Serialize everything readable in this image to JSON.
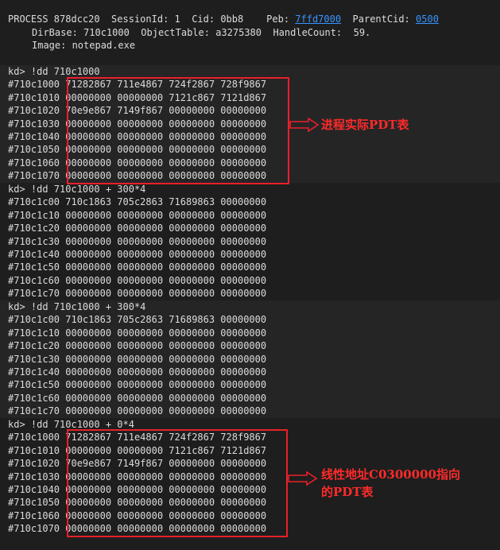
{
  "header": {
    "line1": {
      "process": "PROCESS 878dcc20",
      "session": "SessionId: 1",
      "cid": "Cid: 0bb8",
      "peb_label": "Peb:",
      "peb_value": "7ffd7000",
      "parent_label": "ParentCid:",
      "parent_value": "0500"
    },
    "line2": {
      "dirbase": "DirBase: 710c1000",
      "objtable": "ObjectTable: a3275380",
      "handlecount": "HandleCount:  59."
    },
    "line3": "Image: notepad.exe"
  },
  "blocks": [
    {
      "command": "kd> !dd 710c1000",
      "rows": [
        "#710c1000 71282867 711e4867 724f2867 728f9867",
        "#710c1010 00000000 00000000 7121c867 7121d867",
        "#710c1020 70e9e867 7149f867 00000000 00000000",
        "#710c1030 00000000 00000000 00000000 00000000",
        "#710c1040 00000000 00000000 00000000 00000000",
        "#710c1050 00000000 00000000 00000000 00000000",
        "#710c1060 00000000 00000000 00000000 00000000",
        "#710c1070 00000000 00000000 00000000 00000000"
      ]
    },
    {
      "command": "kd> !dd 710c1000 + 300*4",
      "rows": [
        "#710c1c00 710c1863 705c2863 71689863 00000000",
        "#710c1c10 00000000 00000000 00000000 00000000",
        "#710c1c20 00000000 00000000 00000000 00000000",
        "#710c1c30 00000000 00000000 00000000 00000000",
        "#710c1c40 00000000 00000000 00000000 00000000",
        "#710c1c50 00000000 00000000 00000000 00000000",
        "#710c1c60 00000000 00000000 00000000 00000000",
        "#710c1c70 00000000 00000000 00000000 00000000"
      ]
    },
    {
      "command": "kd> !dd 710c1000 + 300*4",
      "rows": [
        "#710c1c00 710c1863 705c2863 71689863 00000000",
        "#710c1c10 00000000 00000000 00000000 00000000",
        "#710c1c20 00000000 00000000 00000000 00000000",
        "#710c1c30 00000000 00000000 00000000 00000000",
        "#710c1c40 00000000 00000000 00000000 00000000",
        "#710c1c50 00000000 00000000 00000000 00000000",
        "#710c1c60 00000000 00000000 00000000 00000000",
        "#710c1c70 00000000 00000000 00000000 00000000"
      ]
    },
    {
      "command": "kd> !dd 710c1000 + 0*4",
      "rows": [
        "#710c1000 71282867 711e4867 724f2867 728f9867",
        "#710c1010 00000000 00000000 7121c867 7121d867",
        "#710c1020 70e9e867 7149f867 00000000 00000000",
        "#710c1030 00000000 00000000 00000000 00000000",
        "#710c1040 00000000 00000000 00000000 00000000",
        "#710c1050 00000000 00000000 00000000 00000000",
        "#710c1060 00000000 00000000 00000000 00000000",
        "#710c1070 00000000 00000000 00000000 00000000"
      ]
    }
  ],
  "annotations": {
    "first": "进程实际PDT表",
    "second_line1": "线性地址C0300000指向",
    "second_line2": "的PDT表"
  },
  "colors": {
    "background": "#1e1e1e",
    "block_light": "#252526",
    "text": "#dcdcdc",
    "link": "#3794ff",
    "highlight": "#e8202a"
  }
}
